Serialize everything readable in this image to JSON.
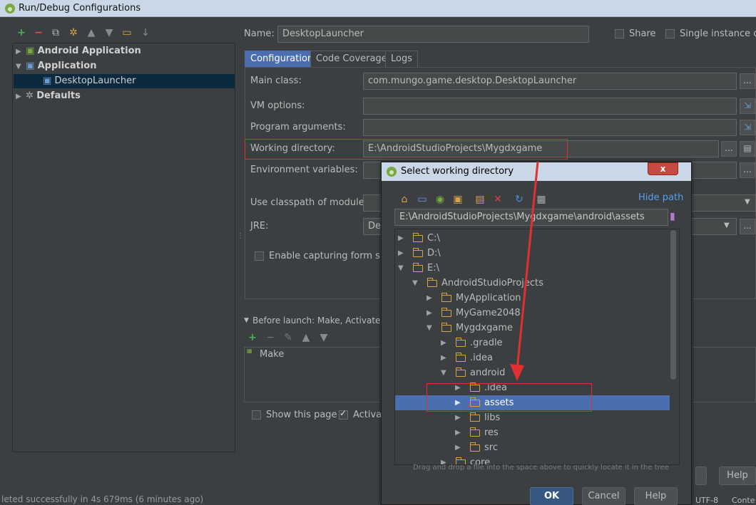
{
  "window": {
    "title": "Run/Debug Configurations"
  },
  "toolbar": {
    "icons": [
      "plus-icon",
      "minus-icon",
      "copy-icon",
      "wrench-icon",
      "arrow-up-icon",
      "arrow-down-icon",
      "folder-icon",
      "sort-icon"
    ]
  },
  "tree": {
    "items": [
      {
        "label": "Android Application"
      },
      {
        "label": "Application"
      },
      {
        "label": "DesktopLauncher"
      },
      {
        "label": "Defaults"
      }
    ]
  },
  "name_row": {
    "label": "Name:",
    "value": "DesktopLauncher",
    "share_label": "Share",
    "single_label": "Single instance onl"
  },
  "tabs": [
    {
      "label": "Configuration"
    },
    {
      "label": "Code Coverage"
    },
    {
      "label": "Logs"
    }
  ],
  "form": {
    "main_class_label": "Main class:",
    "main_class_value": "com.mungo.game.desktop.DesktopLauncher",
    "vm_options_label": "VM options:",
    "program_args_label": "Program arguments:",
    "working_dir_label": "Working directory:",
    "working_dir_value": "E:\\AndroidStudioProjects\\Mygdxgame",
    "env_vars_label": "Environment variables:",
    "classpath_label": "Use classpath of module:",
    "jre_label": "JRE:",
    "jre_value": "De",
    "enable_capture_label": "Enable capturing form sna",
    "ellipsis": "..."
  },
  "before_launch": {
    "header": "Before launch: Make, Activate too",
    "item": "Make",
    "show_page_label": "Show this page",
    "activate_label": "Activa"
  },
  "footer": {
    "help_label": "Help",
    "encoding": "UTF-8",
    "status_text": "leted successfully in 4s 679ms (6 minutes ago)",
    "cont_text": "Conte"
  },
  "dialog": {
    "title": "Select working directory",
    "hide_path": "Hide path",
    "path_value": "E:\\AndroidStudioProjects\\Mygdxgame\\android\\assets",
    "hint": "Drag and drop a file into the space above to quickly locate it in the tree",
    "ok_label": "OK",
    "cancel_label": "Cancel",
    "help_label": "Help",
    "close_label": "x",
    "tree": [
      {
        "label": "C:\\",
        "level": 0,
        "arrow": "right",
        "selected": false
      },
      {
        "label": "D:\\",
        "level": 0,
        "arrow": "right",
        "selected": false
      },
      {
        "label": "E:\\",
        "level": 0,
        "arrow": "down",
        "selected": false
      },
      {
        "label": "AndroidStudioProjects",
        "level": 1,
        "arrow": "down",
        "selected": false
      },
      {
        "label": "MyApplication",
        "level": 2,
        "arrow": "right",
        "selected": false
      },
      {
        "label": "MyGame2048",
        "level": 2,
        "arrow": "right",
        "selected": false
      },
      {
        "label": "Mygdxgame",
        "level": 2,
        "arrow": "down",
        "selected": false
      },
      {
        "label": ".gradle",
        "level": 3,
        "arrow": "right",
        "selected": false
      },
      {
        "label": ".idea",
        "level": 3,
        "arrow": "right",
        "selected": false
      },
      {
        "label": "android",
        "level": 3,
        "arrow": "down",
        "selected": false
      },
      {
        "label": ".idea",
        "level": 4,
        "arrow": "right",
        "selected": false
      },
      {
        "label": "assets",
        "level": 4,
        "arrow": "right",
        "selected": true
      },
      {
        "label": "libs",
        "level": 4,
        "arrow": "right",
        "selected": false
      },
      {
        "label": "res",
        "level": 4,
        "arrow": "right",
        "selected": false
      },
      {
        "label": "src",
        "level": 4,
        "arrow": "right",
        "selected": false
      },
      {
        "label": "core",
        "level": 3,
        "arrow": "right",
        "selected": false
      }
    ]
  },
  "colors": {
    "background": "#3c3f41",
    "selection": "#4b6eaf",
    "annotation": "#e03030",
    "folder": "#d9a343"
  }
}
